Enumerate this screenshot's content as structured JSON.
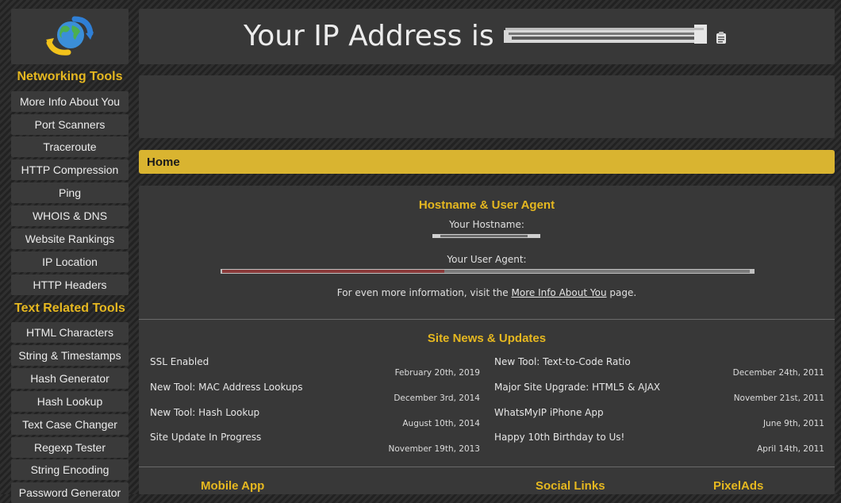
{
  "header": {
    "title_prefix": "Your IP Address is",
    "copy_icon": "clipboard-icon"
  },
  "logo": {
    "icon": "globe-arrows-icon"
  },
  "sidebar": {
    "networking_heading": "Networking Tools",
    "networking_items": [
      "More Info About You",
      "Port Scanners",
      "Traceroute",
      "HTTP Compression",
      "Ping",
      "WHOIS & DNS",
      "Website Rankings",
      "IP Location",
      "HTTP Headers"
    ],
    "text_heading": "Text Related Tools",
    "text_items": [
      "HTML Characters",
      "String & Timestamps",
      "Hash Generator",
      "Hash Lookup",
      "Text Case Changer",
      "Regexp Tester",
      "String Encoding",
      "Password Generator"
    ]
  },
  "breadcrumb": {
    "home": "Home"
  },
  "hostname_section": {
    "title": "Hostname & User Agent",
    "hostname_label": "Your Hostname:",
    "user_agent_label": "Your User Agent:",
    "more_info_prefix": "For even more information, visit the",
    "more_info_link": "More Info About You",
    "more_info_suffix": "page."
  },
  "news": {
    "title": "Site News & Updates",
    "left": [
      {
        "title": "SSL Enabled",
        "date": "February 20th, 2019"
      },
      {
        "title": "New Tool: MAC Address Lookups",
        "date": "December 3rd, 2014"
      },
      {
        "title": "New Tool: Hash Lookup",
        "date": "August 10th, 2014"
      },
      {
        "title": "Site Update In Progress",
        "date": "November 19th, 2013"
      }
    ],
    "right": [
      {
        "title": "New Tool: Text-to-Code Ratio",
        "date": "December 24th, 2011"
      },
      {
        "title": "Major Site Upgrade: HTML5 & AJAX",
        "date": "November 21st, 2011"
      },
      {
        "title": "WhatsMyIP iPhone App",
        "date": "June 9th, 2011"
      },
      {
        "title": "Happy 10th Birthday to Us!",
        "date": "April 14th, 2011"
      }
    ]
  },
  "bottom_sections": {
    "mobile_app": "Mobile App",
    "social_links": "Social Links",
    "pixelads": "PixelAds"
  },
  "colors": {
    "accent": "#e6b820",
    "breadcrumb_bar": "#d9b430",
    "panel": "#383838"
  }
}
